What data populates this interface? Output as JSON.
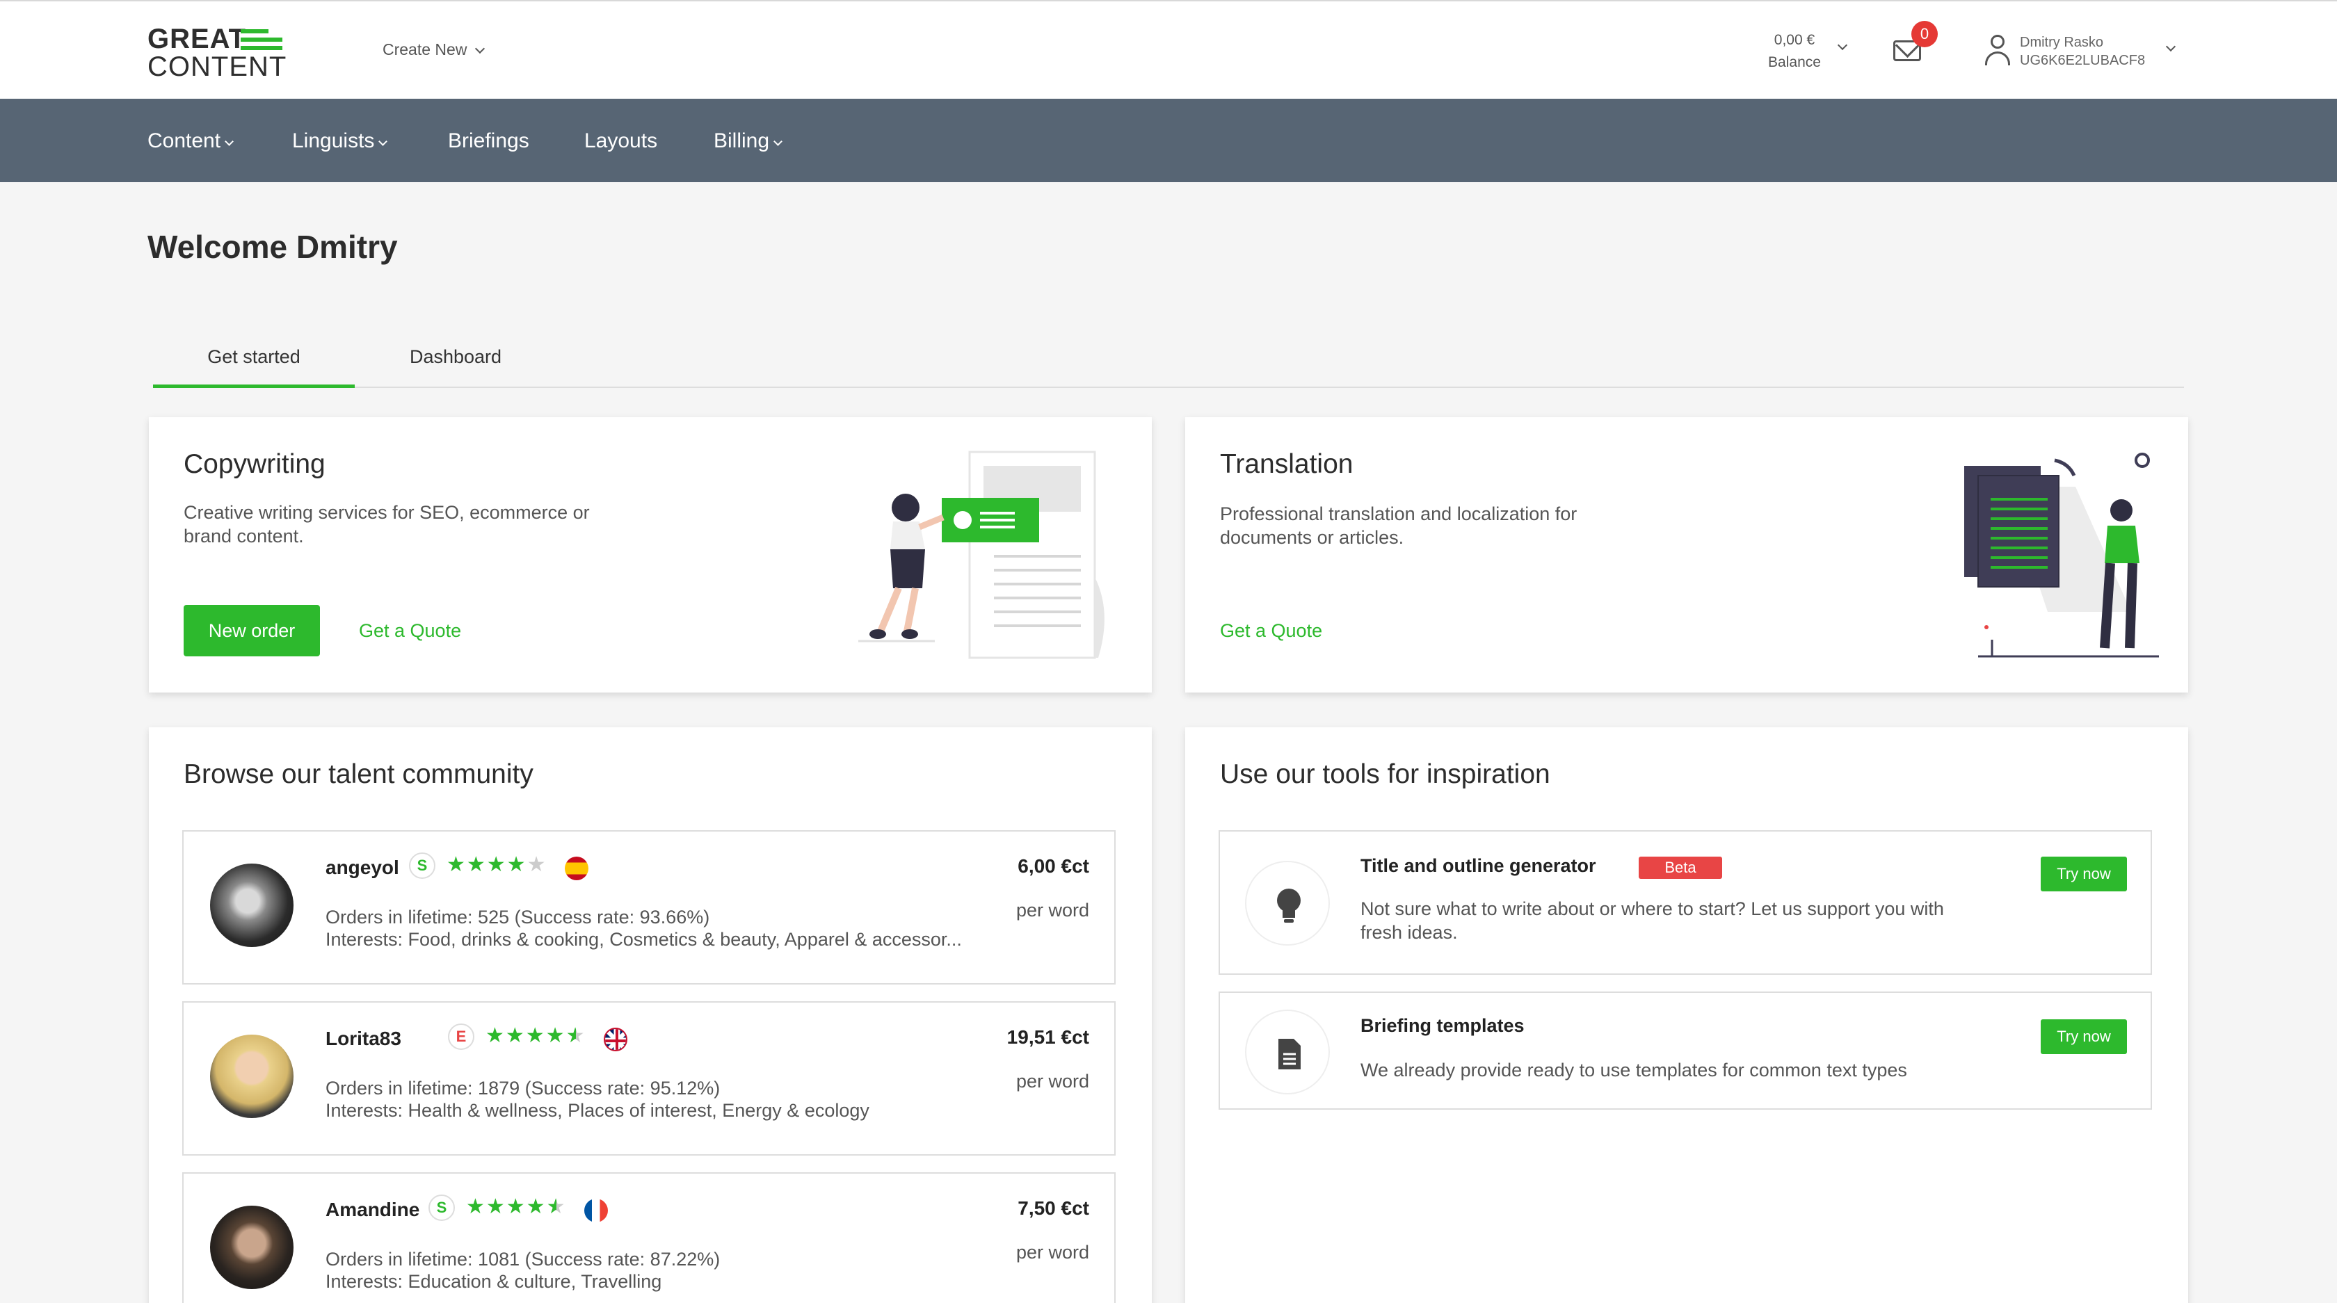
{
  "brand": {
    "line1": "GREAT",
    "line2": "CONTENT",
    "accent": "#2db92d"
  },
  "header": {
    "create_new": "Create New",
    "balance_value": "0,00 €",
    "balance_label": "Balance",
    "mail_count": "0",
    "user_name": "Dmitry Rasko",
    "user_id": "UG6K6E2LUBACF8"
  },
  "nav": {
    "content": "Content",
    "linguists": "Linguists",
    "briefings": "Briefings",
    "layouts": "Layouts",
    "billing": "Billing"
  },
  "welcome": "Welcome Dmitry",
  "tabs": {
    "get_started": "Get started",
    "dashboard": "Dashboard"
  },
  "copywriting": {
    "title": "Copywriting",
    "desc_line1": "Creative writing services for SEO, ecommerce or",
    "desc_line2": "brand content.",
    "new_order": "New order",
    "get_quote": "Get a Quote"
  },
  "translation": {
    "title": "Translation",
    "desc_line1": "Professional translation and localization for",
    "desc_line2": "documents or articles.",
    "get_quote": "Get a Quote"
  },
  "talent": {
    "title": "Browse our talent community",
    "rows": [
      {
        "name": "angeyol",
        "level": "S",
        "rating": 4,
        "orders": "Orders in lifetime: 525 (Success rate: 93.66%)",
        "interests": "Interests: Food, drinks & cooking, Cosmetics & beauty, Apparel & accessor...",
        "price": "6,00 €ct",
        "per": "per word"
      },
      {
        "name": "Lorita83",
        "level": "E",
        "rating": 4.5,
        "orders": "Orders in lifetime: 1879 (Success rate: 95.12%)",
        "interests": "Interests: Health & wellness, Places of interest, Energy & ecology",
        "price": "19,51 €ct",
        "per": "per word"
      },
      {
        "name": "Amandine",
        "level": "S",
        "rating": 4.5,
        "orders": "Orders in lifetime: 1081 (Success rate: 87.22%)",
        "interests": "Interests: Education & culture, Travelling",
        "price": "7,50 €ct",
        "per": "per word"
      }
    ]
  },
  "tools": {
    "title": "Use our tools for inspiration",
    "items": [
      {
        "title": "Title and outline generator",
        "badge": "Beta",
        "desc_line1": "Not sure what to write about or where to start? Let us support you with",
        "desc_line2": "fresh ideas.",
        "cta": "Try now",
        "icon": "lightbulb-icon"
      },
      {
        "title": "Briefing templates",
        "desc_line1": "We already provide ready to use templates for common text types",
        "cta": "Try now",
        "icon": "document-icon"
      }
    ]
  }
}
